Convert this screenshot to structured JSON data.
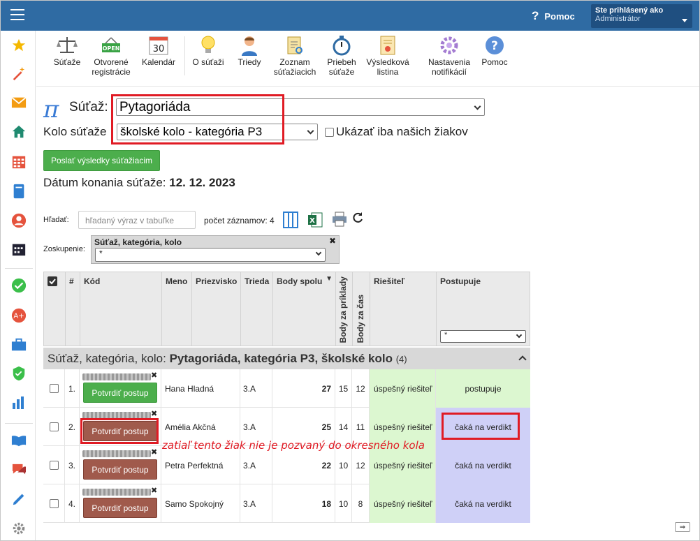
{
  "topbar": {
    "help_label": "Pomoc",
    "user_line1": "Ste prihlásený ako",
    "user_line2": "Administrátor"
  },
  "sidebar": {
    "icons": [
      "star-icon",
      "magic-wand-icon",
      "mail-icon",
      "home-icon",
      "calendar-grid-icon",
      "notebook-icon",
      "user-icon",
      "calendar-icon",
      "check-circle-icon",
      "award-icon",
      "briefcase-icon",
      "shield-check-icon",
      "bar-chart-icon",
      "book-open-icon",
      "chat-icon",
      "pen-icon",
      "gear-icon"
    ]
  },
  "toolbar": {
    "items": [
      {
        "label1": "Súťaže",
        "label2": ""
      },
      {
        "label1": "Otvorené",
        "label2": "registrácie"
      },
      {
        "label1": "Kalendár",
        "label2": ""
      },
      {
        "label1": "O súťaži",
        "label2": ""
      },
      {
        "label1": "Triedy",
        "label2": ""
      },
      {
        "label1": "Zoznam",
        "label2": "súťažiacich"
      },
      {
        "label1": "Priebeh",
        "label2": "súťaže"
      },
      {
        "label1": "Výsledková",
        "label2": "listina"
      },
      {
        "label1": "Nastavenia",
        "label2": "notifikácií"
      },
      {
        "label1": "Pomoc",
        "label2": ""
      }
    ],
    "open_badge": "OPEN",
    "calendar_day": "30"
  },
  "form": {
    "competition_label": "Súťaž:",
    "competition_value": "Pytagoriáda",
    "round_label": "Kolo súťaže",
    "round_value": "školské kolo - kategória P3",
    "only_ours_label": "Ukázať iba našich žiakov",
    "send_button": "Poslať výsledky súťažiacim",
    "date_label": "Dátum konania súťaže:",
    "date_value": "12. 12. 2023"
  },
  "tools": {
    "search_label": "Hľadať:",
    "search_placeholder": "hľadaný výraz v tabuľke",
    "count_label": "počet záznamov: 4",
    "group_label": "Zoskupenie:",
    "group_title": "Súťaž, kategória, kolo",
    "group_select": "*"
  },
  "table": {
    "headers": {
      "num": "#",
      "kod": "Kód",
      "meno": "Meno",
      "priezvisko": "Priezvisko",
      "trieda": "Trieda",
      "body_spolu": "Body spolu",
      "body_priklady": "Body za príklady",
      "body_cas": "Body za čas",
      "riesitel": "Riešiteľ",
      "postupuje": "Postupuje"
    },
    "postupuje_filter": "*",
    "group_prefix": "Súťaž, kategória, kolo:",
    "group_name": "Pytagoriáda, kategória P3, školské kolo",
    "group_count": "(4)",
    "rows": [
      {
        "num": "1.",
        "name": "Hana Hladná",
        "trieda": "3.A",
        "total": "27",
        "priklady": "15",
        "cas": "12",
        "riesitel": "úspešný riešiteľ",
        "postup": "postupuje",
        "button": "Potvrdiť postup"
      },
      {
        "num": "2.",
        "name": "Amélia Akčná",
        "trieda": "3.A",
        "total": "25",
        "priklady": "14",
        "cas": "11",
        "riesitel": "úspešný riešiteľ",
        "postup": "čaká na verdikt",
        "button": "Potvrdiť postup"
      },
      {
        "num": "3.",
        "name": "Petra Perfektná",
        "trieda": "3.A",
        "total": "22",
        "priklady": "10",
        "cas": "12",
        "riesitel": "úspešný riešiteľ",
        "postup": "čaká na verdikt",
        "button": "Potvrdiť postup"
      },
      {
        "num": "4.",
        "name": "Samo Spokojný",
        "trieda": "3.A",
        "total": "18",
        "priklady": "10",
        "cas": "8",
        "riesitel": "úspešný riešiteľ",
        "postup": "čaká na verdikt",
        "button": "Potvrdiť postup"
      }
    ]
  },
  "annotation": "zatiaľ tento žiak nie je pozvaný do okresného kola",
  "colors": {
    "accent": "#2f6ba3",
    "green": "#4cae4c",
    "brown": "#a05a4c",
    "highlight_red": "#e01b24",
    "success_bg": "#dcf7d0",
    "pending_bg": "#cfd0f7"
  }
}
